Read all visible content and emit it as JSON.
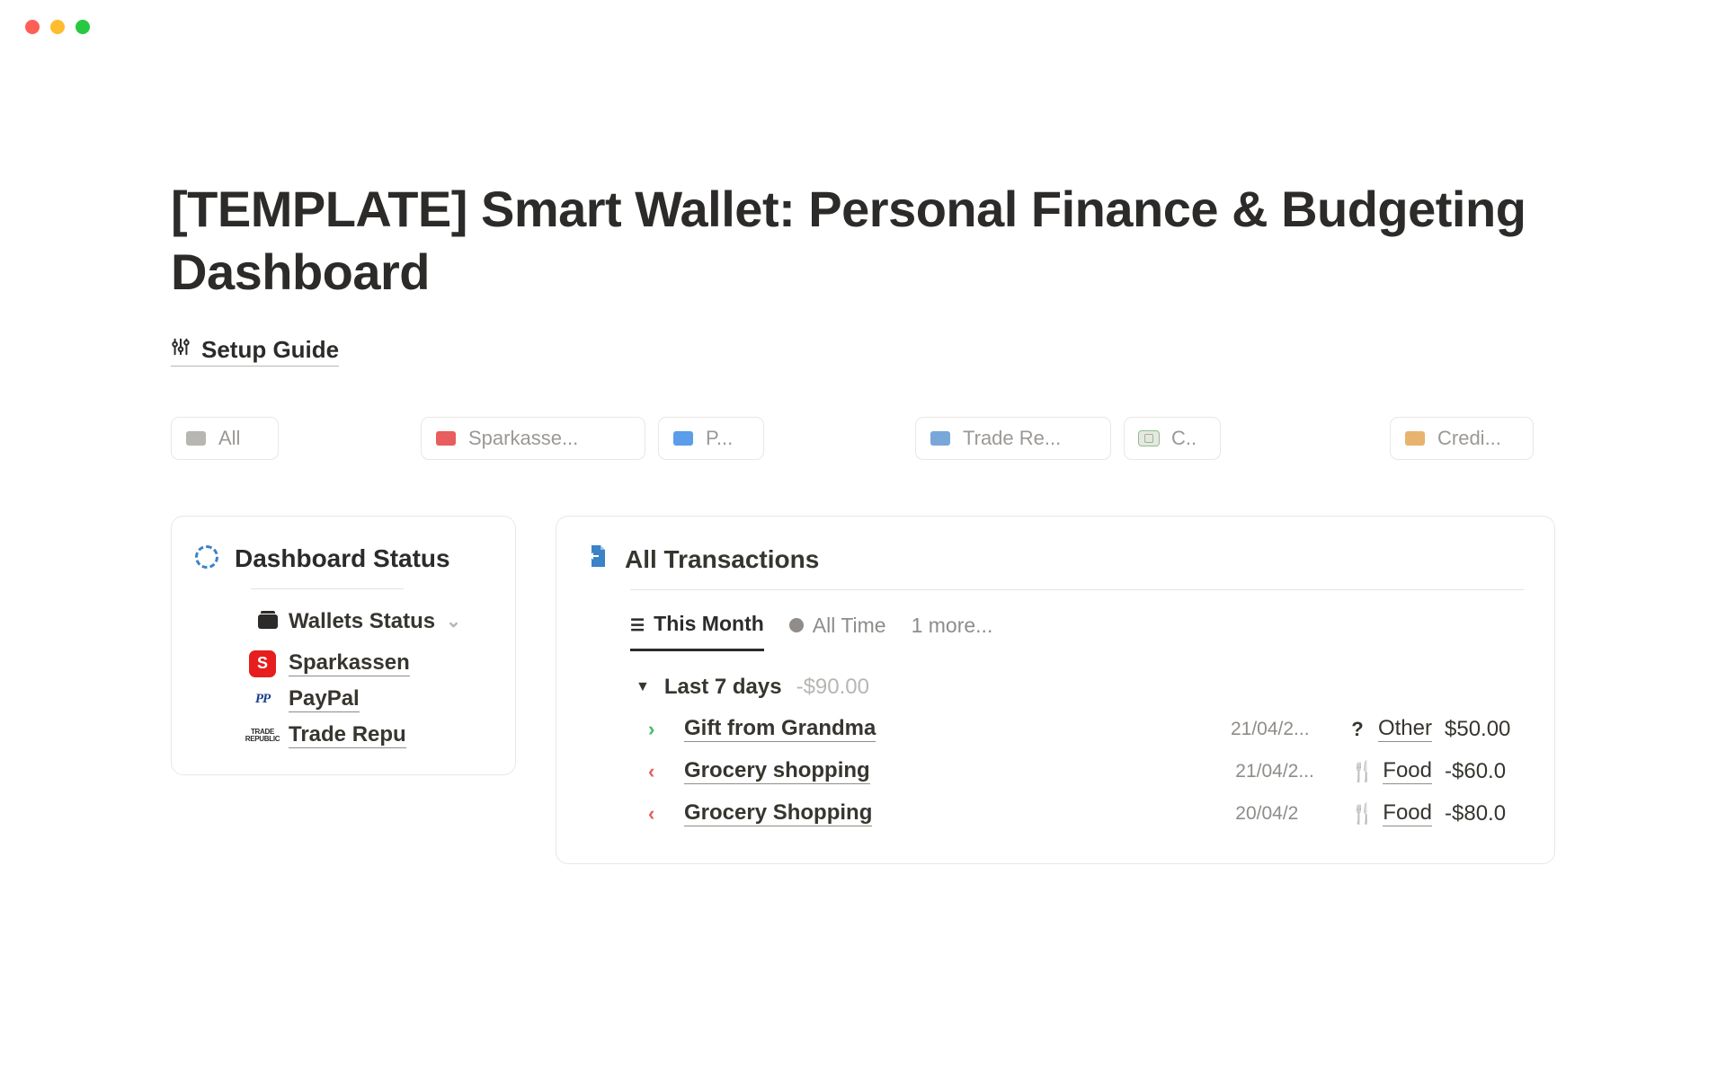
{
  "page_title": "[TEMPLATE] Smart Wallet: Personal Finance & Budgeting Dashboard",
  "setup_guide_label": "Setup Guide",
  "wallet_tabs": [
    {
      "label": "All",
      "color": "grey"
    },
    {
      "label": "Sparkasse...",
      "color": "red"
    },
    {
      "label": "P...",
      "color": "blue"
    },
    {
      "label": "Trade Re...",
      "color": "blue2"
    },
    {
      "label": "C..",
      "color": "green"
    },
    {
      "label": "Credi...",
      "color": "orange"
    }
  ],
  "sidebar": {
    "title": "Dashboard Status",
    "wallets_header": "Wallets Status",
    "items": [
      {
        "label": "Sparkassen",
        "icon": "spark"
      },
      {
        "label": "PayPal",
        "icon": "pp"
      },
      {
        "label": "Trade Repu",
        "icon": "tr"
      }
    ]
  },
  "transactions": {
    "title": "All Transactions",
    "views": [
      {
        "label": "This Month",
        "active": true,
        "icon": "list"
      },
      {
        "label": "All Time",
        "active": false,
        "icon": "dot"
      }
    ],
    "more_label": "1 more...",
    "group": {
      "label": "Last 7 days",
      "amount": "-$90.00"
    },
    "rows": [
      {
        "dir": "in",
        "name": "Gift from Grandma",
        "date": "21/04/2...",
        "cat_icon": "?",
        "cat": "Other",
        "amount": "$50.00"
      },
      {
        "dir": "out",
        "name": "Grocery shopping",
        "date": "21/04/2...",
        "cat_icon": "🍴",
        "cat": "Food",
        "amount": "-$60.0"
      },
      {
        "dir": "out",
        "name": "Grocery Shopping",
        "date": "20/04/2",
        "cat_icon": "🍴",
        "cat": "Food",
        "amount": "-$80.0"
      }
    ]
  }
}
